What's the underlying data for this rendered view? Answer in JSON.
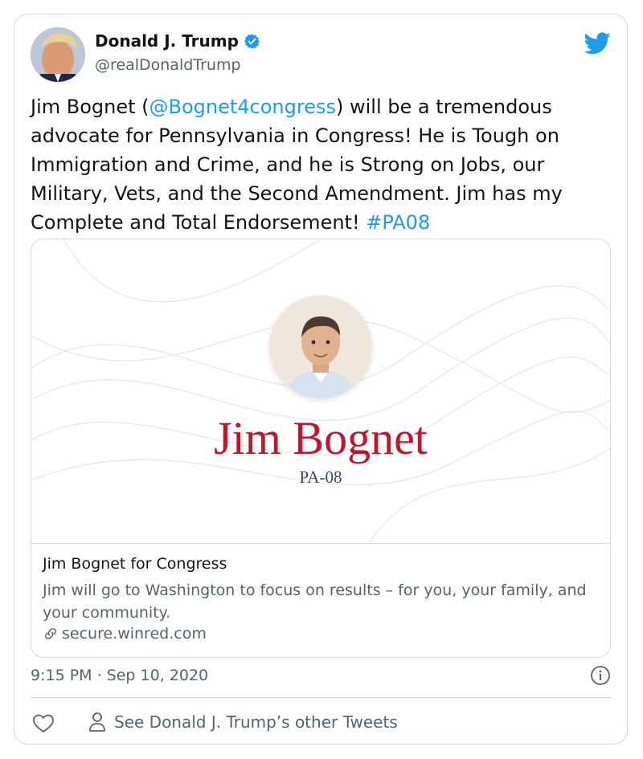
{
  "author": {
    "display_name": "Donald J. Trump",
    "handle": "@realDonaldTrump",
    "verified": true
  },
  "tweet": {
    "text_parts": [
      {
        "text": "Jim Bognet (",
        "link": false
      },
      {
        "text": "@Bognet4congress",
        "link": true
      },
      {
        "text": ") will be a tremendous advocate for Pennsylvania in Congress! He is Tough on Immigration and Crime, and he is Strong on Jobs, our Military, Vets, and the Second Amendment. Jim has my Complete and Total Endorsement! ",
        "link": false
      },
      {
        "text": "#PA08",
        "link": true
      }
    ],
    "timestamp": "9:15 PM · Sep 10, 2020"
  },
  "card": {
    "image_name": "Jim Bognet",
    "image_district": "PA-08",
    "title": "Jim Bognet for Congress",
    "description": "Jim will go to Washington to focus on results – for you, your family, and your community.",
    "domain": "secure.winred.com"
  },
  "footer": {
    "see_more_label": "See Donald J. Trump’s other Tweets"
  },
  "colors": {
    "link": "#1d9bf0",
    "secondary_text": "#536471",
    "border": "#cfd9de",
    "candidate_red": "#c2152b",
    "district_blue": "#2a4a7a"
  },
  "icons": [
    "avatar",
    "verified-badge-icon",
    "twitter-bird-icon",
    "portrait",
    "link-icon",
    "info-icon",
    "heart-icon",
    "person-icon"
  ]
}
